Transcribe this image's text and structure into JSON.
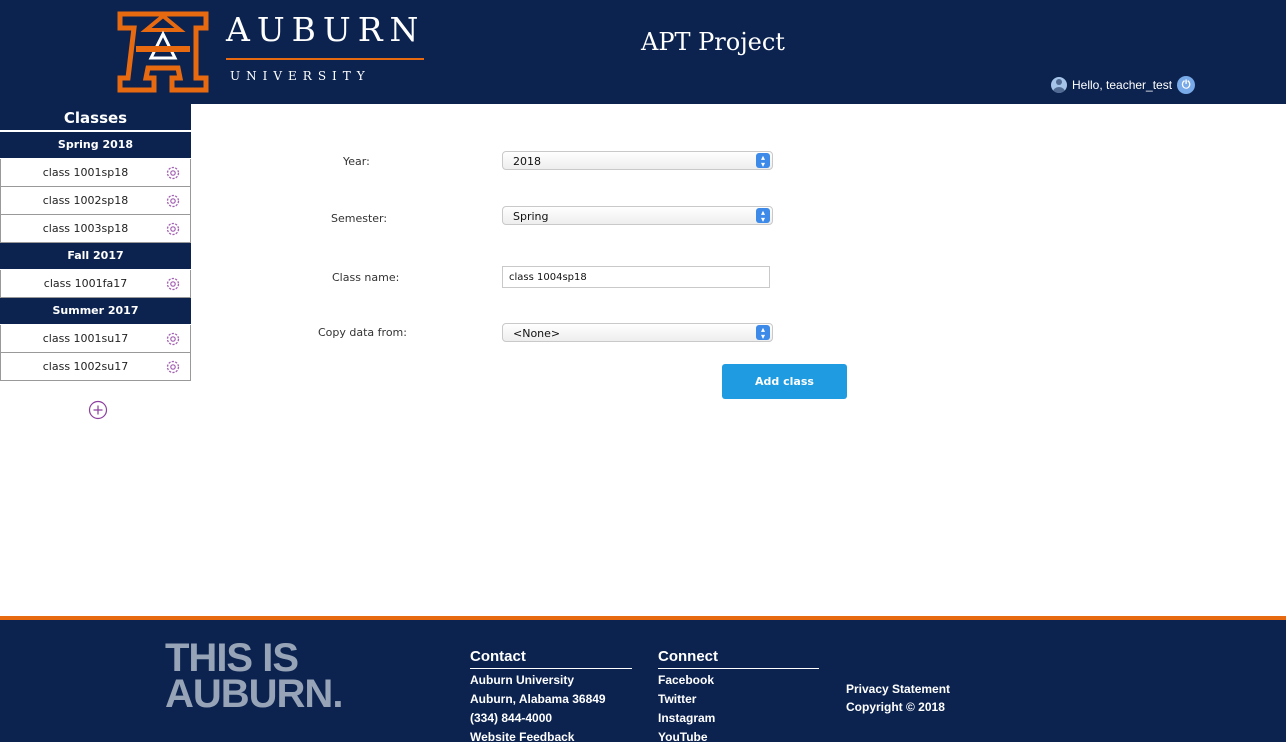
{
  "header": {
    "logo_mark": "AU",
    "logo_auburn": "AUBURN",
    "logo_university": "UNIVERSITY",
    "app_title": "APT Project",
    "greeting": "Hello, teacher_test",
    "colors": {
      "navy": "#0c2350",
      "orange": "#e86a10"
    }
  },
  "sidebar": {
    "title": "Classes",
    "terms": [
      {
        "name": "Spring 2018",
        "classes": [
          "class 1001sp18",
          "class 1002sp18",
          "class 1003sp18"
        ]
      },
      {
        "name": "Fall 2017",
        "classes": [
          "class 1001fa17"
        ]
      },
      {
        "name": "Summer 2017",
        "classes": [
          "class 1001su17",
          "class 1002su17"
        ]
      }
    ],
    "class_icon": "gear-icon",
    "add_icon": "plus-circle-icon"
  },
  "form": {
    "year_label": "Year:",
    "year_value": "2018",
    "semester_label": "Semester:",
    "semester_value": "Spring",
    "class_name_label": "Class name:",
    "class_name_value": "class 1004sp18",
    "copy_label": "Copy data from:",
    "copy_value": "<None>",
    "submit_label": "Add class",
    "accent": "#1f9ce1"
  },
  "footer": {
    "brand_line1": "THIS IS",
    "brand_line2": "AUBURN.",
    "contact": {
      "heading": "Contact",
      "lines": [
        "Auburn University",
        "Auburn, Alabama 36849",
        "(334) 844-4000",
        "Website Feedback"
      ]
    },
    "connect": {
      "heading": "Connect",
      "links": [
        "Facebook",
        "Twitter",
        "Instagram",
        "YouTube"
      ]
    },
    "privacy": "Privacy Statement",
    "copyright": "Copyright © 2018"
  }
}
